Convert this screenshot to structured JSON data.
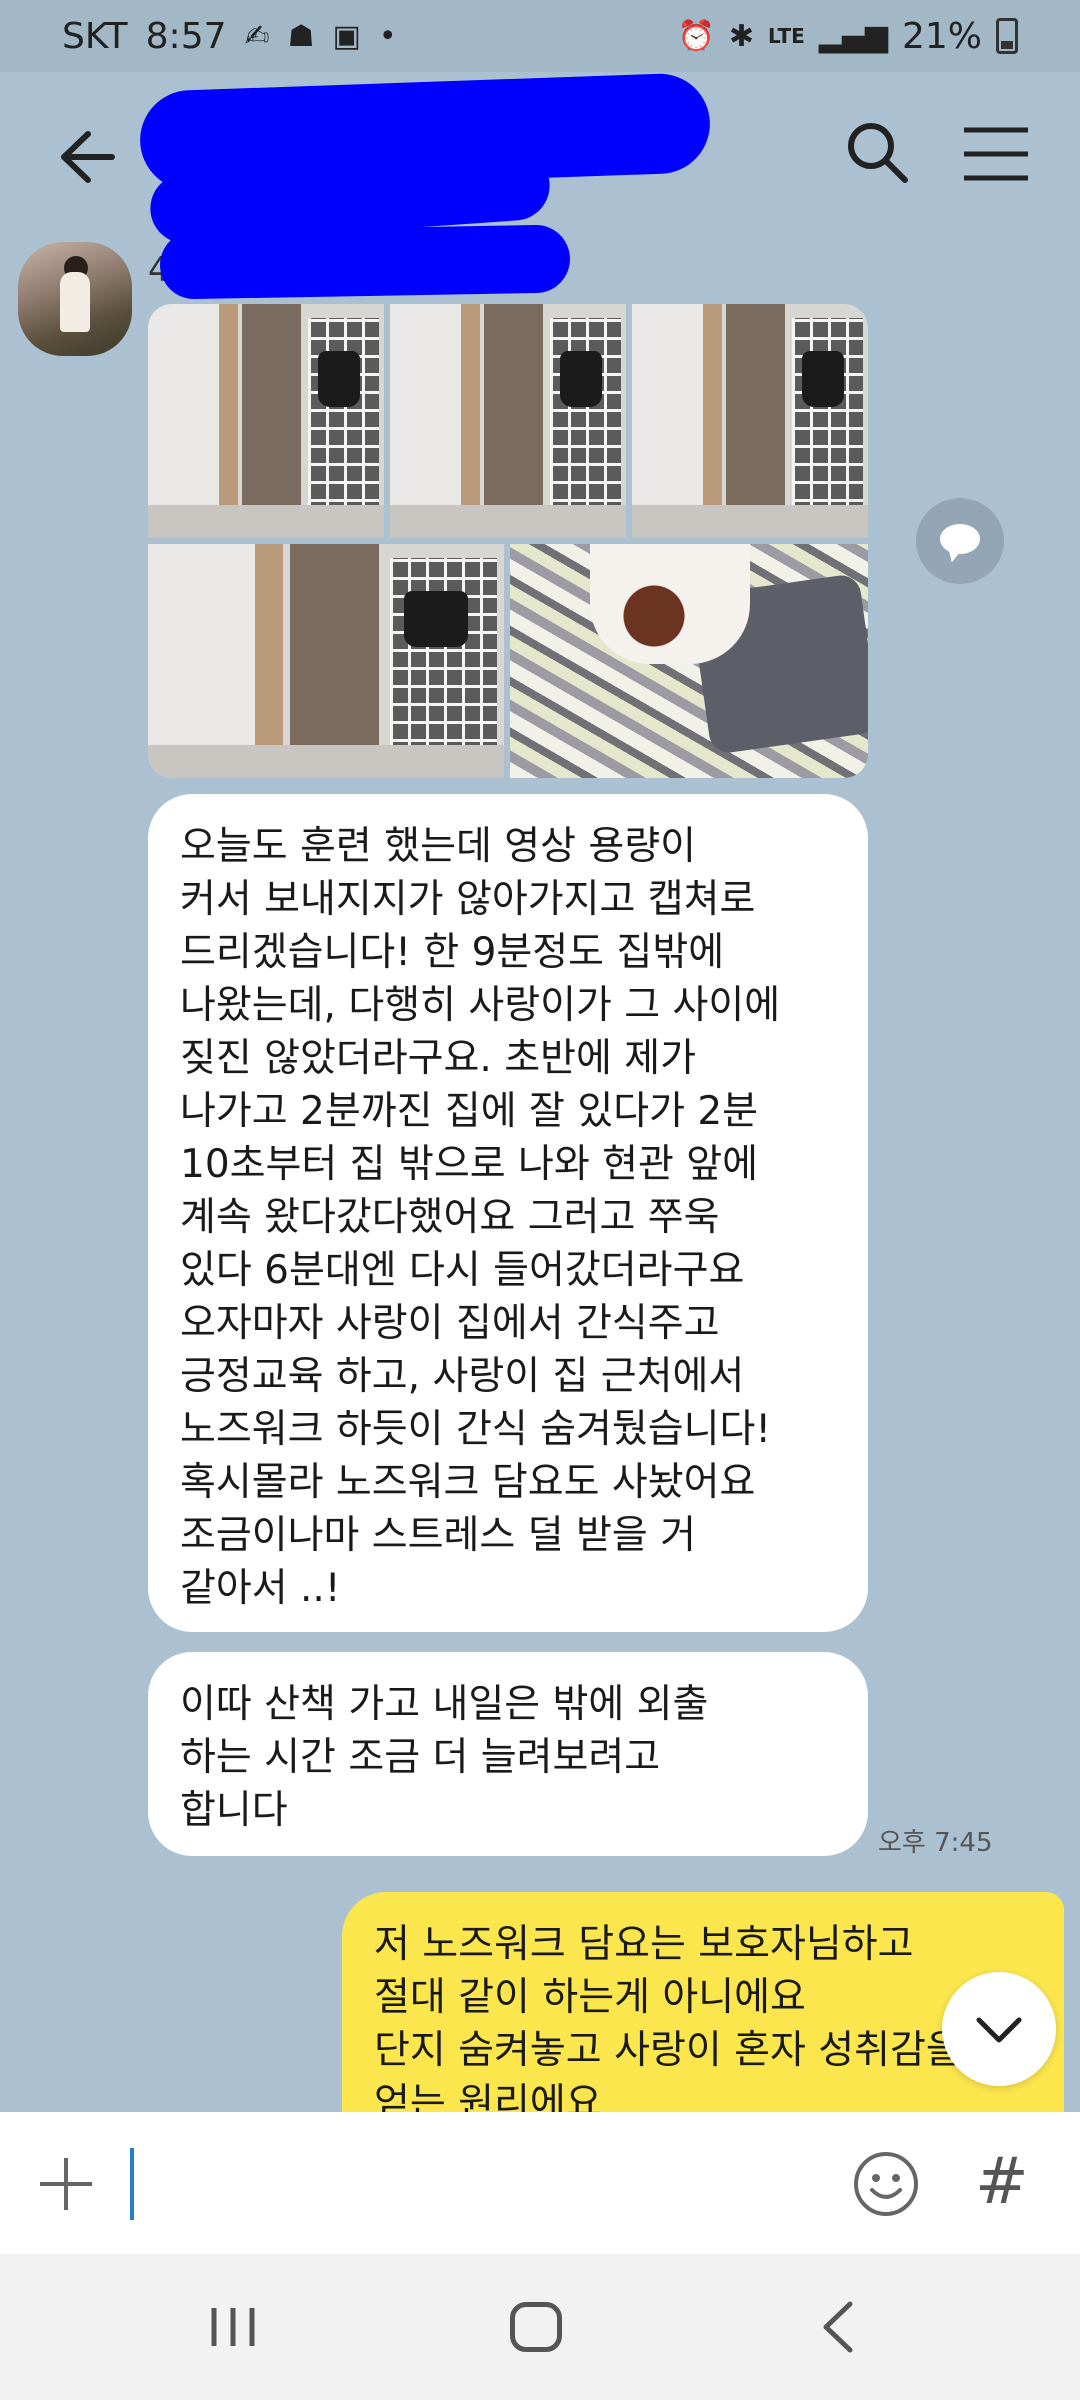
{
  "status_bar": {
    "carrier": "SKT",
    "time": "8:57",
    "network": "LTE",
    "battery": "21%",
    "icons": [
      "notification-icon",
      "person-icon",
      "gallery-icon",
      "dot-icon",
      "alarm-icon",
      "bluetooth-icon",
      "lte-icon",
      "signal-icon",
      "battery-icon"
    ]
  },
  "chat": {
    "sender_name": "4",
    "incoming_message_1": "오늘도 훈련 했는데 영상 용량이 \n커서 보내지지가 않아가지고 캡쳐로 \n드리겠습니다! 한 9분정도 집밖에 \n나왔는데, 다행히 사랑이가 그 사이에 \n짖진 않았더라구요. 초반에 제가 \n나가고 2분까진 집에 잘 있다가 2분 \n10초부터 집 밖으로 나와 현관 앞에 \n계속 왔다갔다했어요 그러고 쭈욱 \n있다 6분대엔 다시 들어갔더라구요 \n오자마자 사랑이 집에서 간식주고 \n긍정교육 하고, 사랑이 집 근처에서 \n노즈워크 하듯이 간식 숨겨뒀습니다! \n혹시몰라 노즈워크 담요도 사놨어요 \n조금이나마 스트레스 덜 받을 거 \n같아서 ..!",
    "incoming_message_2": "이따 산책 가고 내일은 밖에 외출 \n하는 시간 조금 더 늘려보려고 \n합니다",
    "incoming_time": "오후 7:45",
    "outgoing_message": "저 노즈워크 담요는 보호자님하고 \n절대 같이 하는게 아니에요 \n단지 숨켜놓고 사랑이 혼자 성취감을 \n얻는 원리에요"
  },
  "input": {
    "value": "",
    "placeholder": ""
  },
  "colors": {
    "background": "#abc1d1",
    "outgoing_bubble": "#fbe64d",
    "incoming_bubble": "#ffffff",
    "redaction": "#0000ff"
  }
}
